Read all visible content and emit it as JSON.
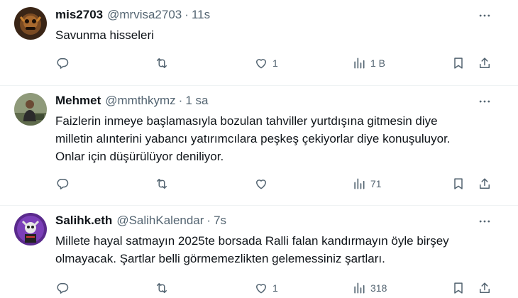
{
  "tweets": [
    {
      "name": "mis2703",
      "handle": "@mrvisa2703",
      "separator": "·",
      "time": "11s",
      "text_lines": [
        "Savunma hisseleri"
      ],
      "replies": "",
      "retweets": "",
      "likes": "1",
      "views": "1 B"
    },
    {
      "name": "Mehmet",
      "handle": "@mmthkymz",
      "separator": "·",
      "time": "1 sa",
      "text_lines": [
        "Faizlerin inmeye başlamasıyla bozulan tahviller yurtdışına gitmesin diye",
        "milletin alınterini yabancı yatırımcılara peşkeş çekiyorlar diye konuşuluyor.",
        "Onlar için düşürülüyor deniliyor."
      ],
      "replies": "",
      "retweets": "",
      "likes": "",
      "views": "71"
    },
    {
      "name": "Salihk.eth",
      "handle": "@SalihKalendar",
      "separator": "·",
      "time": "7s",
      "text_lines": [
        "Millete hayal satmayın 2025te borsada Ralli falan kandırmayın öyle birşey",
        "olmayacak. Şartlar belli görmemezlikten gelemessiniz şartları."
      ],
      "replies": "",
      "retweets": "",
      "likes": "1",
      "views": "318"
    }
  ],
  "icons": {
    "more": "more-dots-icon",
    "reply": "reply-icon",
    "retweet": "retweet-icon",
    "like": "heart-icon",
    "views": "views-icon",
    "bookmark": "bookmark-icon",
    "share": "share-icon"
  },
  "colors": {
    "text": "#0f1419",
    "secondary": "#536471",
    "divider": "#eff3f4"
  }
}
